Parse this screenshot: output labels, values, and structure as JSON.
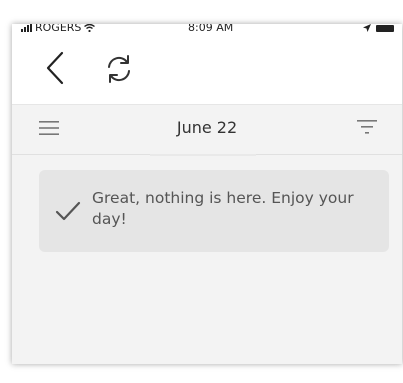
{
  "status_bar": {
    "carrier": "ROGERS",
    "time": "8:09 AM",
    "wifi_icon": "wifi-icon",
    "location_icon": "location-arrow-icon",
    "battery_icon": "battery-icon"
  },
  "nav": {
    "back_icon": "chevron-left-icon",
    "refresh_icon": "refresh-icon"
  },
  "date_header": {
    "title": "June 22",
    "menu_icon": "hamburger-menu-icon",
    "filter_icon": "filter-icon"
  },
  "empty_state": {
    "icon": "checkmark-icon",
    "message": "Great, nothing is here. Enjoy your day!"
  },
  "colors": {
    "background": "#f3f3f3",
    "card": "#e5e5e5",
    "text": "#555555",
    "title": "#333333"
  }
}
